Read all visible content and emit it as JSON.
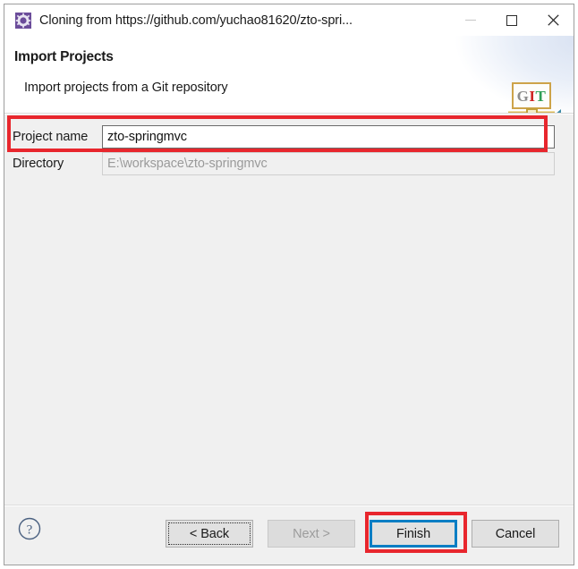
{
  "window": {
    "title": "Cloning from https://github.com/yuchao81620/zto-spri...",
    "title_icon": "eclipse-gear-icon",
    "controls": {
      "minimize": "minimize-icon",
      "maximize": "maximize-icon",
      "close": "close-icon"
    }
  },
  "header": {
    "title": "Import Projects",
    "subtitle": "Import projects from a Git repository",
    "banner_icon": "git-wizard-banner-icon",
    "banner_text": {
      "g": "G",
      "i": "I",
      "t": "T"
    }
  },
  "form": {
    "fields": [
      {
        "label": "Project name",
        "value": "zto-springmvc",
        "placeholder": "",
        "readonly": false
      },
      {
        "label": "Directory",
        "value": "E:\\workspace\\zto-springmvc",
        "placeholder": "",
        "readonly": true
      }
    ]
  },
  "footer": {
    "help_icon": "help-question-icon",
    "buttons": [
      {
        "label": "< Back",
        "state": "focus-dotted"
      },
      {
        "label": "Next >",
        "state": "disabled"
      },
      {
        "label": "Finish",
        "state": "default-focus"
      },
      {
        "label": "Cancel",
        "state": "normal"
      }
    ]
  },
  "annotations": {
    "project_name_highlight": "red-rectangle",
    "finish_highlight": "red-rectangle",
    "color": "#e8262d",
    "focus_color": "#0b7ec4"
  }
}
